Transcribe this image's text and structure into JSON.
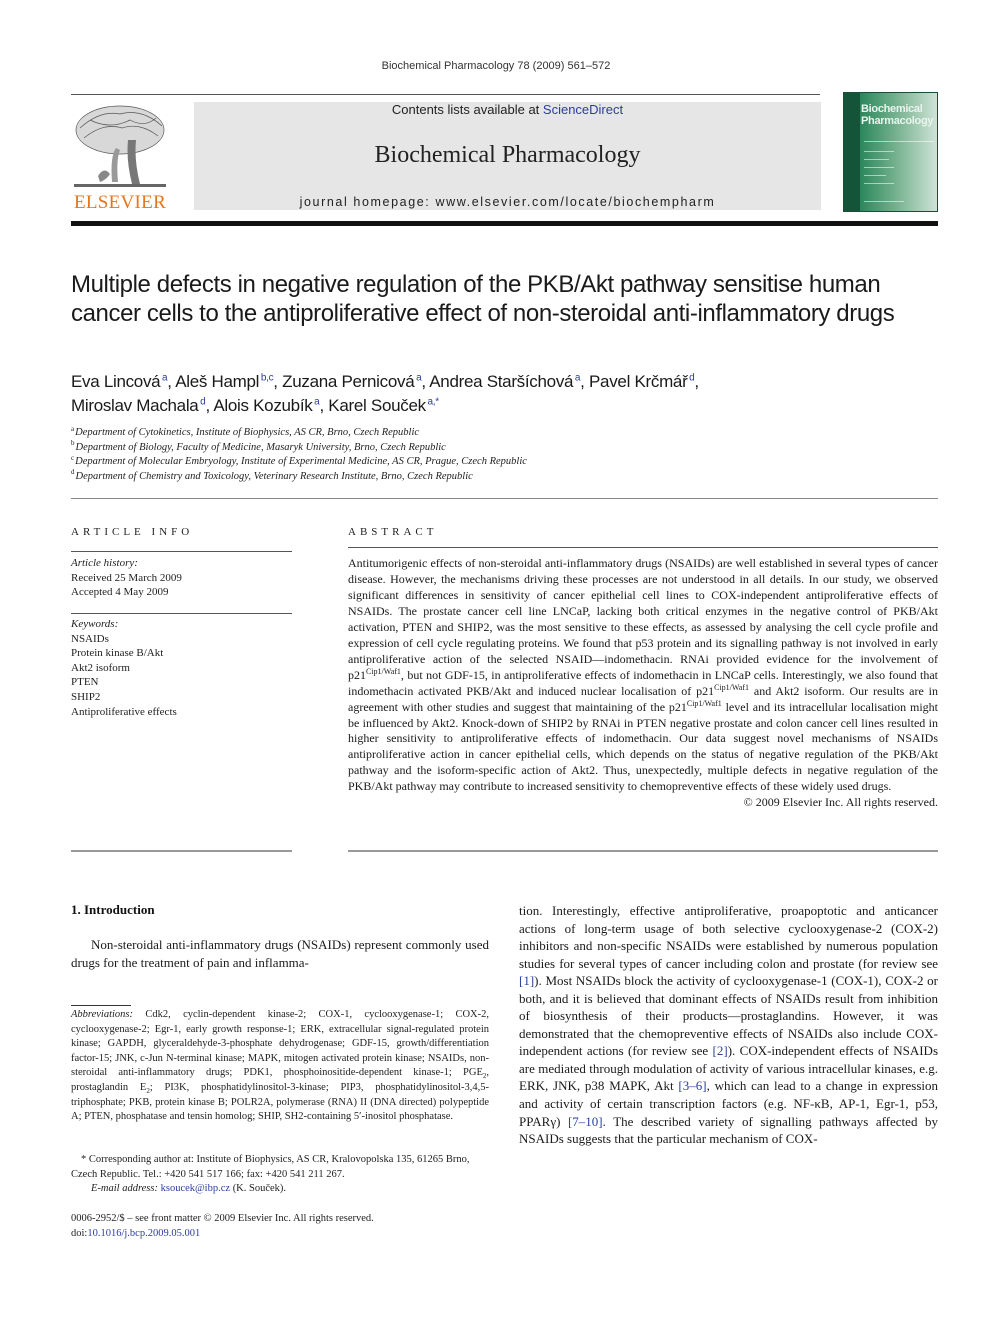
{
  "header": {
    "running_head": "Biochemical Pharmacology 78 (2009) 561–572",
    "contents_prefix": "Contents lists available at ",
    "contents_link": "ScienceDirect",
    "journal_title": "Biochemical Pharmacology",
    "homepage": "journal homepage: www.elsevier.com/locate/biochempharm",
    "publisher_logo_text": "ELSEVIER",
    "cover_title_line1": "Biochemical",
    "cover_title_line2": "Pharmacology"
  },
  "colors": {
    "link": "#2b3e9c",
    "elsevier_orange": "#e8751a",
    "masthead_gray": "#e6e6e6",
    "cover_green": "#2f8a5f"
  },
  "article": {
    "title": "Multiple defects in negative regulation of the PKB/Akt pathway sensitise human cancer cells to the antiproliferative effect of non-steroidal anti-inflammatory drugs",
    "authors": [
      {
        "name": "Eva Lincová",
        "aff": "a",
        "sep": ", "
      },
      {
        "name": "Aleš Hampl",
        "aff": "b,c",
        "sep": ", "
      },
      {
        "name": "Zuzana Pernicová",
        "aff": "a",
        "sep": ", "
      },
      {
        "name": "Andrea Staršíchová",
        "aff": "a",
        "sep": ", "
      },
      {
        "name": "Pavel Krčmář",
        "aff": "d",
        "sep": ","
      },
      {
        "name": "Miroslav Machala",
        "aff": "d",
        "sep": ", "
      },
      {
        "name": "Alois Kozubík",
        "aff": "a",
        "sep": ", "
      },
      {
        "name": "Karel Souček",
        "aff": "a,*",
        "sep": ""
      }
    ],
    "affiliations": [
      {
        "key": "a",
        "text": "Department of Cytokinetics, Institute of Biophysics, AS CR, Brno, Czech Republic"
      },
      {
        "key": "b",
        "text": "Department of Biology, Faculty of Medicine, Masaryk University, Brno, Czech Republic"
      },
      {
        "key": "c",
        "text": "Department of Molecular Embryology, Institute of Experimental Medicine, AS CR, Prague, Czech Republic"
      },
      {
        "key": "d",
        "text": "Department of Chemistry and Toxicology, Veterinary Research Institute, Brno, Czech Republic"
      }
    ]
  },
  "article_info": {
    "heading": "ARTICLE INFO",
    "history_label": "Article history:",
    "received": "Received 25 March 2009",
    "accepted": "Accepted 4 May 2009",
    "keywords_label": "Keywords:",
    "keywords": [
      "NSAIDs",
      "Protein kinase B/Akt",
      "Akt2 isoform",
      "PTEN",
      "SHIP2",
      "Antiproliferative effects"
    ]
  },
  "abstract": {
    "heading": "ABSTRACT",
    "p1": "Antitumorigenic effects of non-steroidal anti-inflammatory drugs (NSAIDs) are well established in several types of cancer disease. However, the mechanisms driving these processes are not understood in all details. In our study, we observed significant differences in sensitivity of cancer epithelial cell lines to COX-independent antiproliferative effects of NSAIDs. The prostate cancer cell line LNCaP, lacking both critical enzymes in the negative control of PKB/Akt activation, PTEN and SHIP2, was the most sensitive to these effects, as assessed by analysing the cell cycle profile and expression of cell cycle regulating proteins. We found that p53 protein and its signalling pathway is not involved in early antiproliferative action of the selected NSAID—indomethacin. RNAi provided evidence for the involvement of p21",
    "sup1": "Cip1/Waf1",
    "p2": ", but not GDF-15, in antiproliferative effects of indomethacin in LNCaP cells. Interestingly, we also found that indomethacin activated PKB/Akt and induced nuclear localisation of p21",
    "sup2": "Cip1/Waf1",
    "p3": " and Akt2 isoform. Our results are in agreement with other studies and suggest that maintaining of the p21",
    "sup3": "Cip1/Waf1",
    "p4": " level and its intracellular localisation might be influenced by Akt2. Knock-down of SHIP2 by RNAi in PTEN negative prostate and colon cancer cell lines resulted in higher sensitivity to antiproliferative effects of indomethacin. Our data suggest novel mechanisms of NSAIDs antiproliferative action in cancer epithelial cells, which depends on the status of negative regulation of the PKB/Akt pathway and the isoform-specific action of Akt2. Thus, unexpectedly, multiple defects in negative regulation of the PKB/Akt pathway may contribute to increased sensitivity to chemopreventive effects of these widely used drugs.",
    "copyright": "© 2009 Elsevier Inc. All rights reserved."
  },
  "introduction": {
    "heading": "1. Introduction",
    "para_left": "Non-steroidal anti-inflammatory drugs (NSAIDs) represent commonly used drugs for the treatment of pain and inflamma-",
    "col2_a": "tion. Interestingly, effective antiproliferative, proapoptotic and anticancer actions of long-term usage of both selective cyclooxygenase-2 (COX-2) inhibitors and non-specific NSAIDs were established by numerous population studies for several types of cancer including colon and prostate (for review see ",
    "ref1": "[1]",
    "col2_b": "). Most NSAIDs block the activity of cyclooxygenase-1 (COX-1), COX-2 or both, and it is believed that dominant effects of NSAIDs result from inhibition of biosynthesis of their products—prostaglandins. However, it was demonstrated that the chemopreventive effects of NSAIDs also include COX-independent actions (for review see ",
    "ref2": "[2]",
    "col2_c": "). COX-independent effects of NSAIDs are mediated through modulation of activity of various intracellular kinases, e.g. ERK, JNK, p38 MAPK, Akt ",
    "ref3": "[3–6]",
    "col2_d": ", which can lead to a change in expression and activity of certain transcription factors (e.g. NF-κB, AP-1, Egr-1, p53, PPARγ) ",
    "ref4": "[7–10]",
    "col2_e": ". The described variety of signalling pathways affected by NSAIDs suggests that the particular mechanism of COX-"
  },
  "footnotes": {
    "abbrev_label": "Abbreviations:",
    "abbrev_a": " Cdk2, cyclin-dependent kinase-2; COX-1, cyclooxygenase-1; COX-2, cyclooxygenase-2; Egr-1, early growth response-1; ERK, extracellular signal-regulated protein kinase; GAPDH, glyceraldehyde-3-phosphate dehydrogenase; GDF-15, growth/differentiation factor-15; JNK, c-Jun N-terminal kinase; MAPK, mitogen activated protein kinase; NSAIDs, non-steroidal anti-inflammatory drugs; PDK1, phosphoinositide-dependent kinase-1; PGE",
    "sub1": "2",
    "abbrev_b": ", prostaglandin E",
    "sub2": "2",
    "abbrev_c": "; PI3K, phosphatidylinositol-3-kinase; PIP3, phosphatidylinositol-3,4,5-triphosphate; PKB, protein kinase B; POLR2A, polymerase (RNA) II (DNA directed) polypeptide A; PTEN, phosphatase and tensin homolog; SHIP, SH2-containing 5′-inositol phosphatase.",
    "corresp_line1": "* Corresponding author at: Institute of Biophysics, AS CR, Kralovopolska 135, 61265 Brno, Czech Republic. Tel.: +420 541 517 166; fax: +420 541 211 267.",
    "email_label": "E-mail address:",
    "email": "ksoucek@ibp.cz",
    "email_suffix": " (K. Souček).",
    "issn_line": "0006-2952/$ – see front matter © 2009 Elsevier Inc. All rights reserved.",
    "doi_prefix": "doi:",
    "doi": "10.1016/j.bcp.2009.05.001"
  }
}
